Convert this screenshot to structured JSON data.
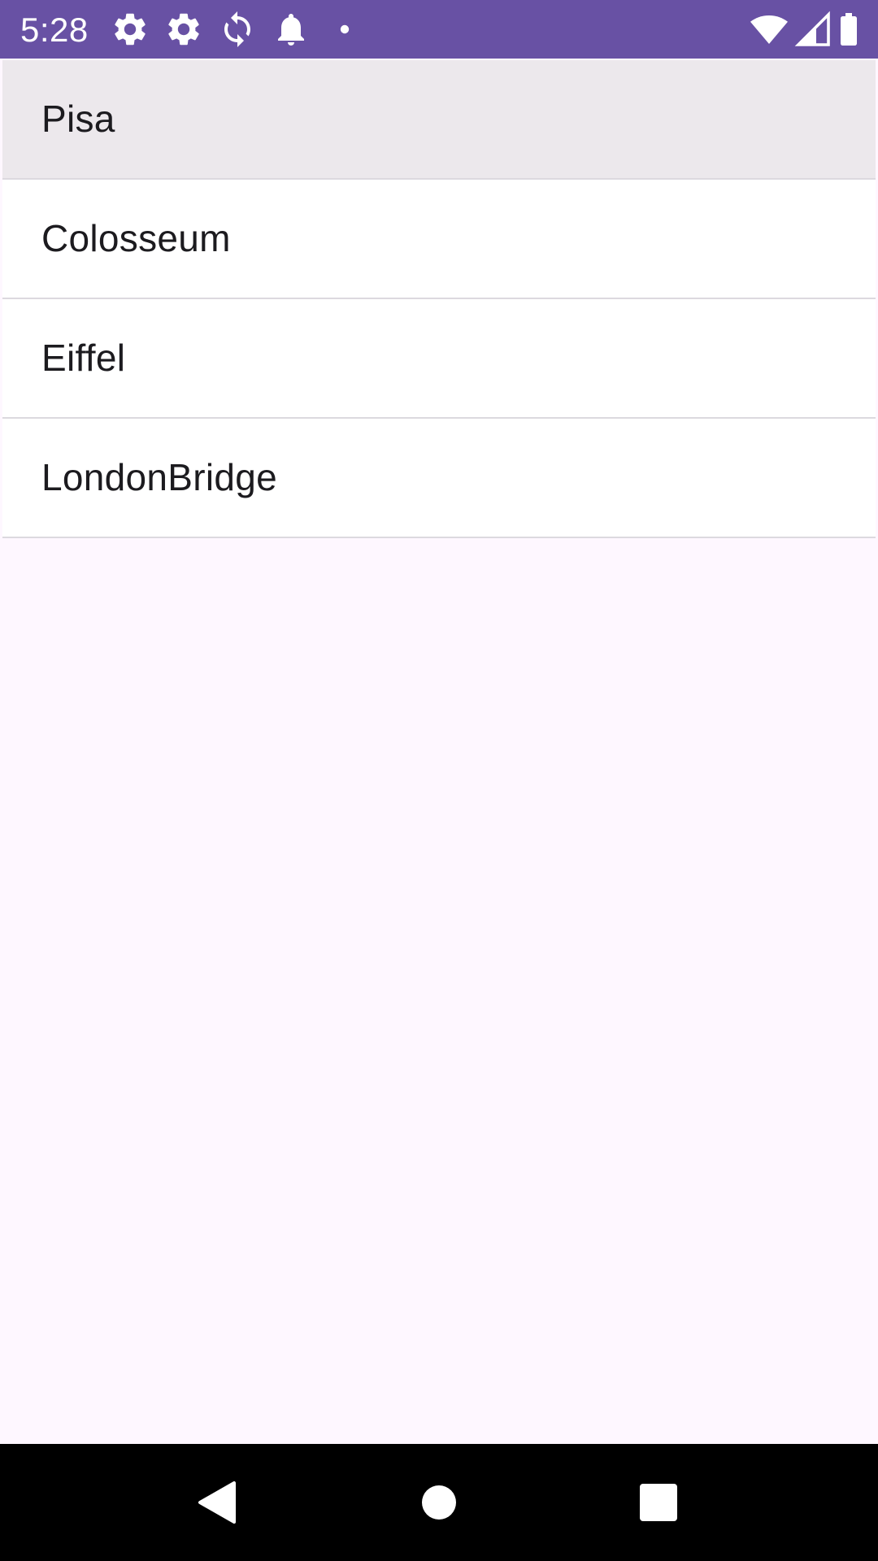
{
  "status_bar": {
    "time": "5:28",
    "background": "#6851A4",
    "left_icons": [
      "settings-icon",
      "settings-icon",
      "sync-icon",
      "notification-bell-icon",
      "dot-icon"
    ],
    "right_icons": [
      "wifi-icon",
      "cell-signal-icon",
      "battery-icon"
    ]
  },
  "list": {
    "selected_index": 0,
    "items": [
      {
        "label": "Pisa"
      },
      {
        "label": "Colosseum"
      },
      {
        "label": "Eiffel"
      },
      {
        "label": "LondonBridge"
      }
    ]
  },
  "nav_bar": {
    "buttons": [
      "back-icon",
      "home-icon",
      "recents-icon"
    ]
  },
  "colors": {
    "accent": "#6851A4",
    "background": "#FEF7FF",
    "selected_item": "#ECE8EC",
    "text": "#1C1B1F",
    "divider": "#DCD9DF"
  }
}
